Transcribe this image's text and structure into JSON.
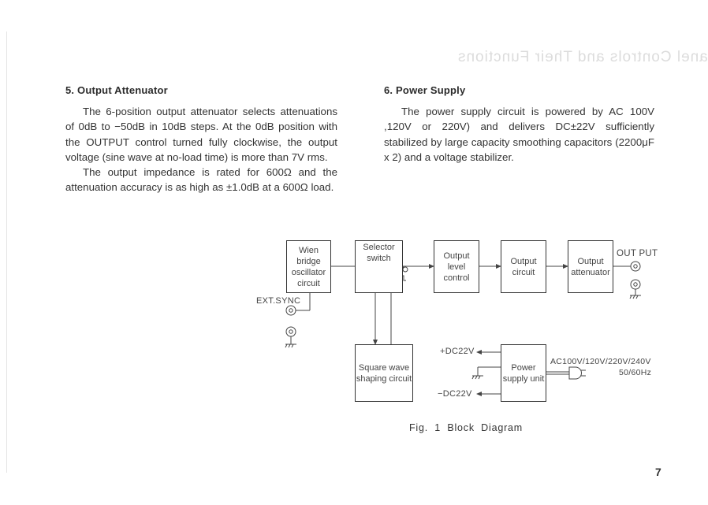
{
  "page": {
    "ghost_title": "Panel Controls and Their Functions",
    "page_number": "7"
  },
  "section5": {
    "heading": "5. Output Attenuator",
    "paragraphs": [
      "The 6-position output attenuator selects attenuations of 0dB to −50dB in 10dB steps. At the 0dB position with the OUTPUT control turned fully clockwise, the output voltage (sine wave at no-load time) is more than 7V rms.",
      "The output impedance is rated for 600Ω and the attenuation accuracy is as high as ±1.0dB at a 600Ω load."
    ]
  },
  "section6": {
    "heading": "6. Power Supply",
    "paragraphs": [
      "The power supply circuit is powered by AC 100V ,120V or 220V) and delivers DC±22V sufficiently stabilized by large capacity smoothing capacitors (2200μF x 2) and a voltage stabilizer."
    ]
  },
  "diagram": {
    "caption": "Fig. 1   Block Diagram",
    "blocks": {
      "wien": "Wien bridge oscillator circuit",
      "selector": "Selector switch",
      "level": "Output level control",
      "output_circuit": "Output circuit",
      "attenuator": "Output attenuator",
      "square": "Square wave shaping circuit",
      "power": "Power supply unit"
    },
    "labels": {
      "ext_sync": "EXT.SYNC",
      "output": "OUT PUT",
      "plus_dc": "+DC22V",
      "minus_dc": "−DC22V",
      "ac_input": "AC100V/120V/220V/240V",
      "frequency": "50/60Hz",
      "sine_symbol": "∿",
      "square_symbol": "⎍"
    }
  }
}
